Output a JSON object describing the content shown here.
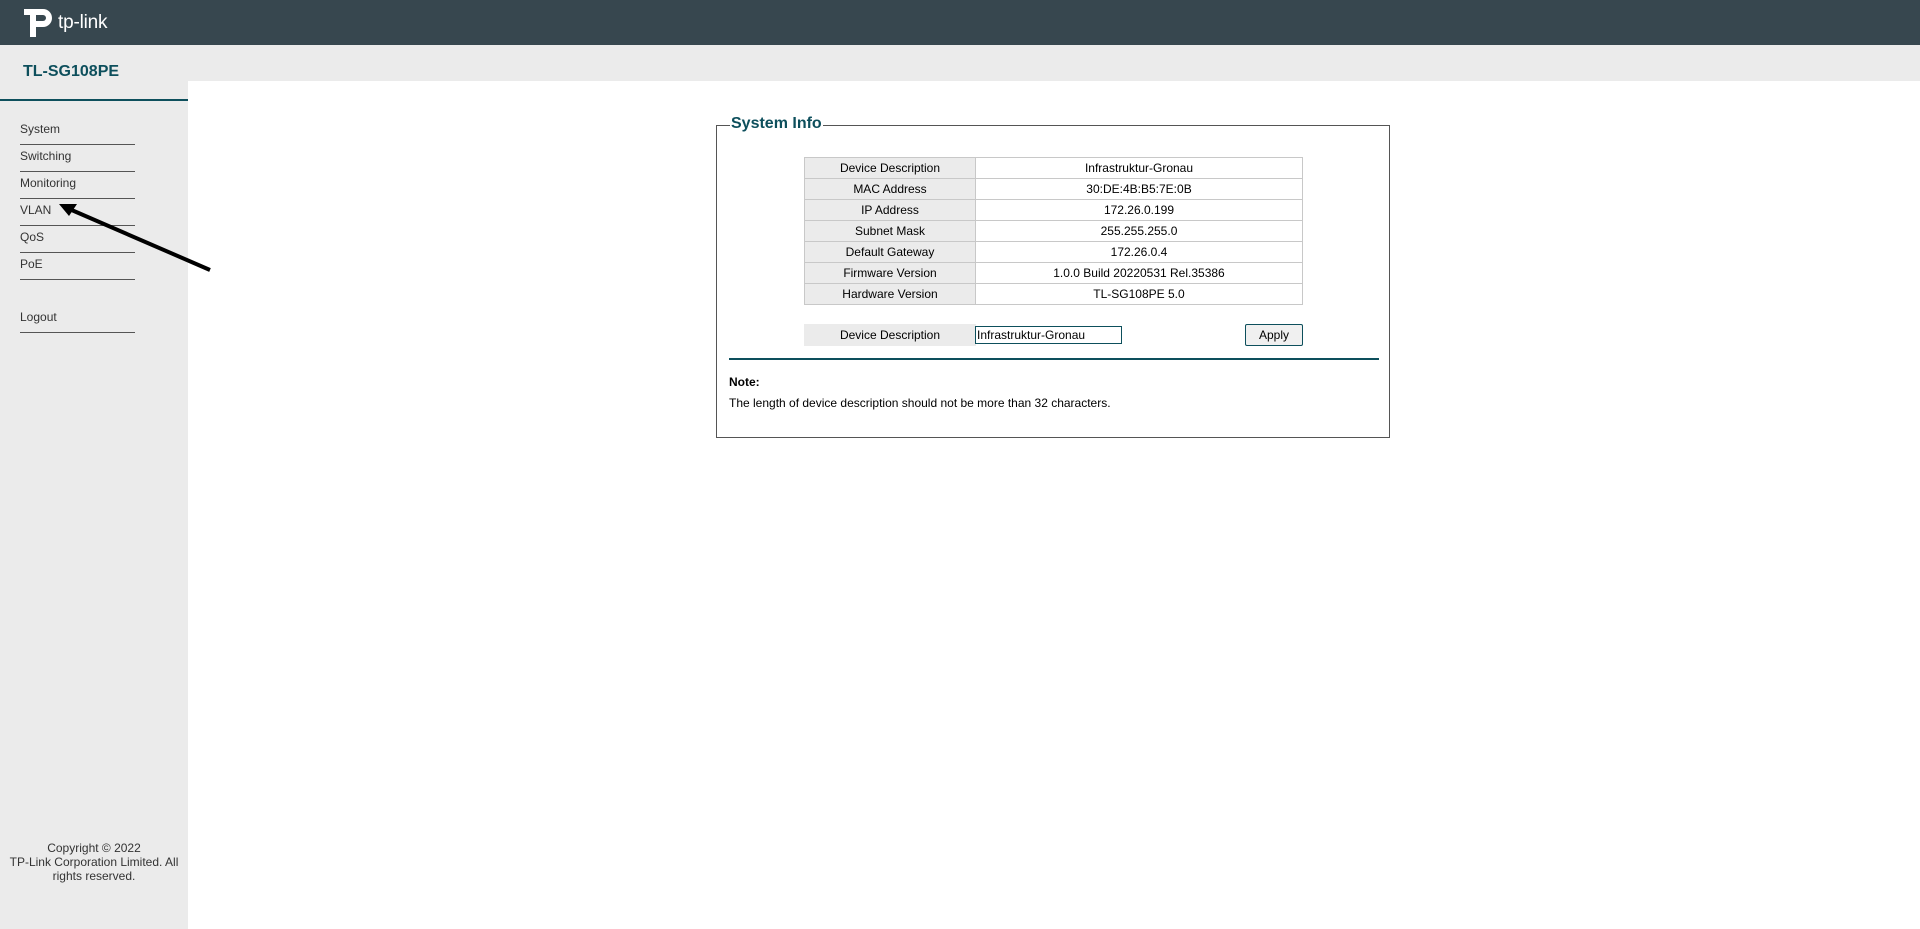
{
  "header": {
    "brand": "tp-link"
  },
  "sidebar": {
    "model": "TL-SG108PE",
    "items": [
      {
        "label": "System"
      },
      {
        "label": "Switching"
      },
      {
        "label": "Monitoring"
      },
      {
        "label": "VLAN"
      },
      {
        "label": "QoS"
      },
      {
        "label": "PoE"
      }
    ],
    "logout": "Logout",
    "copyright": "Copyright © 2022\nTP-Link Corporation Limited. All rights reserved."
  },
  "main": {
    "section_title": "System Info",
    "info_rows": [
      {
        "label": "Device Description",
        "value": "Infrastruktur-Gronau"
      },
      {
        "label": "MAC Address",
        "value": "30:DE:4B:B5:7E:0B"
      },
      {
        "label": "IP Address",
        "value": "172.26.0.199"
      },
      {
        "label": "Subnet Mask",
        "value": "255.255.255.0"
      },
      {
        "label": "Default Gateway",
        "value": "172.26.0.4"
      },
      {
        "label": "Firmware Version",
        "value": "1.0.0 Build 20220531 Rel.35386"
      },
      {
        "label": "Hardware Version",
        "value": "TL-SG108PE 5.0"
      }
    ],
    "edit": {
      "label": "Device Description",
      "value": "Infrastruktur-Gronau",
      "apply_label": "Apply"
    },
    "note": {
      "title": "Note:",
      "text": "The length of device description should not be more than 32 characters."
    }
  },
  "colors": {
    "topbar": "#37474f",
    "accent": "#0d4f5c",
    "sidebar_bg": "#ebebeb"
  }
}
